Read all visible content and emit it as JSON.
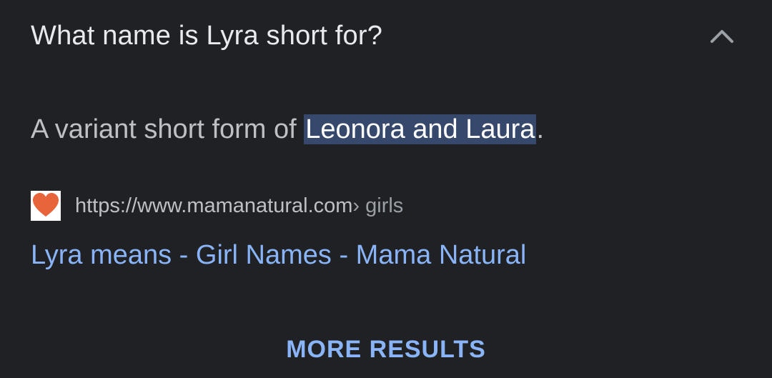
{
  "question": {
    "text": "What name is Lyra short for?",
    "chevron_icon": "chevron-up-icon"
  },
  "answer": {
    "prefix": "A variant short form of ",
    "highlighted": "Leonora and Laura",
    "suffix": "."
  },
  "source": {
    "favicon_icon": "heart-icon",
    "url": "https://www.mamanatural.com",
    "path": " › girls"
  },
  "result": {
    "link_text": "Lyra means - Girl Names - Mama Natural"
  },
  "more_results_label": "MORE RESULTS",
  "colors": {
    "background": "#202124",
    "text": "#e8eaed",
    "muted": "#bdc1c6",
    "link": "#8ab4f8",
    "highlight": "#36486b",
    "favicon_heart": "#e8643a"
  }
}
